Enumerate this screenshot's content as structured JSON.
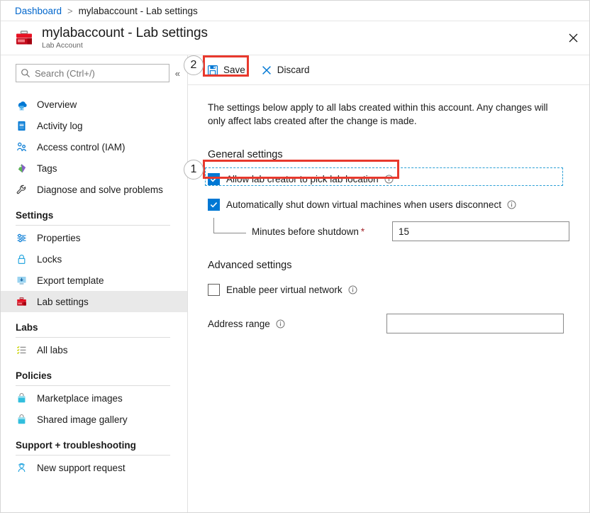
{
  "breadcrumb": {
    "root": "Dashboard",
    "separator": ">",
    "current": "mylabaccount - Lab settings"
  },
  "header": {
    "title": "mylabaccount - Lab settings",
    "subtitle": "Lab Account",
    "resource_icon": "lab-account-toolbox-icon",
    "close_icon": "close-icon"
  },
  "sidebar": {
    "search": {
      "placeholder": "Search (Ctrl+/)",
      "icon": "search-icon"
    },
    "collapse_icon": "«",
    "top_items": [
      {
        "label": "Overview",
        "icon": "overview-cloud-icon"
      },
      {
        "label": "Activity log",
        "icon": "activity-log-icon"
      },
      {
        "label": "Access control (IAM)",
        "icon": "access-control-icon"
      },
      {
        "label": "Tags",
        "icon": "tags-icon"
      },
      {
        "label": "Diagnose and solve problems",
        "icon": "wrench-icon"
      }
    ],
    "groups": [
      {
        "title": "Settings",
        "items": [
          {
            "label": "Properties",
            "icon": "properties-sliders-icon",
            "selected": false
          },
          {
            "label": "Locks",
            "icon": "lock-icon",
            "selected": false
          },
          {
            "label": "Export template",
            "icon": "export-template-icon",
            "selected": false
          },
          {
            "label": "Lab settings",
            "icon": "lab-settings-toolbox-icon",
            "selected": true
          }
        ]
      },
      {
        "title": "Labs",
        "items": [
          {
            "label": "All labs",
            "icon": "all-labs-list-icon",
            "selected": false
          }
        ]
      },
      {
        "title": "Policies",
        "items": [
          {
            "label": "Marketplace images",
            "icon": "marketplace-bag-icon",
            "selected": false
          },
          {
            "label": "Shared image gallery",
            "icon": "shared-gallery-bag-icon",
            "selected": false
          }
        ]
      },
      {
        "title": "Support + troubleshooting",
        "items": [
          {
            "label": "New support request",
            "icon": "support-person-icon",
            "selected": false
          }
        ]
      }
    ]
  },
  "toolbar": {
    "save_label": "Save",
    "save_icon": "save-disk-icon",
    "discard_label": "Discard",
    "discard_icon": "discard-x-icon"
  },
  "main": {
    "intro": "The settings below apply to all labs created within this account. Any changes will only affect labs created after the change is made.",
    "general": {
      "title": "General settings",
      "allow_location": {
        "label": "Allow lab creator to pick lab location",
        "checked": true,
        "info_icon": "info-icon",
        "focused": true
      },
      "auto_shutdown": {
        "label": "Automatically shut down virtual machines when users disconnect",
        "checked": true,
        "info_icon": "info-icon"
      },
      "minutes_before_shutdown": {
        "label": "Minutes before shutdown",
        "required_marker": "*",
        "value": "15"
      }
    },
    "advanced": {
      "title": "Advanced settings",
      "enable_peer_vnet": {
        "label": "Enable peer virtual network",
        "checked": false,
        "info_icon": "info-icon"
      },
      "address_range": {
        "label": "Address range",
        "value": "",
        "info_icon": "info-icon"
      }
    }
  },
  "annotations": [
    {
      "number": "1",
      "target": "allow-lab-creator-checkbox"
    },
    {
      "number": "2",
      "target": "save-button"
    }
  ],
  "colors": {
    "accent_blue": "#0078d4",
    "link_blue": "#0066cc",
    "annotation_red": "#e8392d",
    "focus_dashed": "#2a9fd6",
    "required_red": "#a4262c",
    "selected_bg": "#e9e9e9"
  }
}
